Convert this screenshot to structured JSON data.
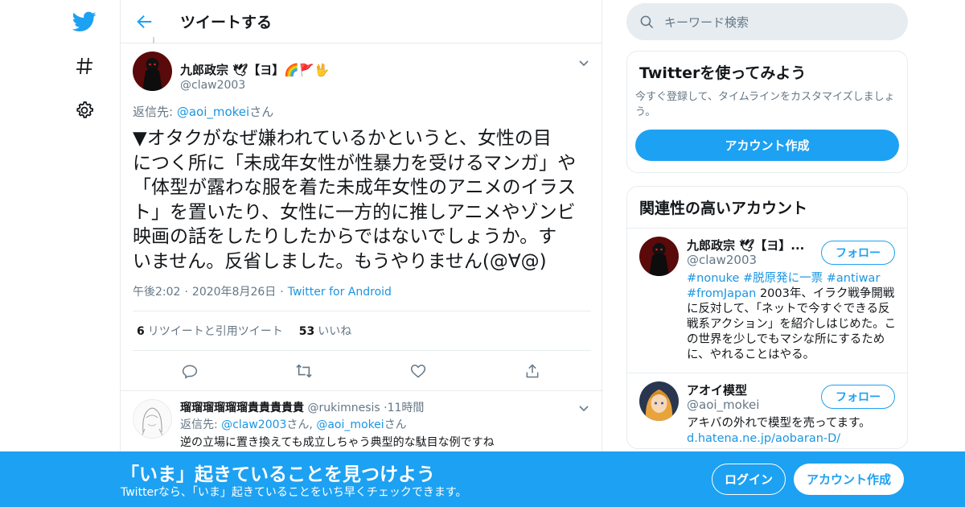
{
  "nav": {
    "logo_icon": "twitter-bird-icon",
    "explore_icon": "hashtag-icon",
    "settings_icon": "gear-icon"
  },
  "header": {
    "title": "ツイートする",
    "back_icon": "arrow-left-icon"
  },
  "tweet": {
    "author_name": "九郎政宗 🕊【ヨ】🌈🚩🖖",
    "author_handle": "@claw2003",
    "reply_prefix": "返信先: ",
    "reply_to": "@aoi_mokei",
    "reply_suffix": "さん",
    "text": "▼オタクがなぜ嫌われているかというと、女性の目\nにつく所に「未成年女性が性暴力を受けるマンガ」や\n「体型が露わな服を着た未成年女性のアニメのイラス\nト」を置いたり、女性に一方的に推しアニメやゾンビ\n映画の話をしたりしたからではないでしょうか。す\nいません。反省しました。もうやりません(@∀@)",
    "time": "午後2:02",
    "date": "2020年8月26日",
    "source": "Twitter for Android",
    "retweets_count": "6",
    "retweets_label": "リツイートと引用ツイート",
    "likes_count": "53",
    "likes_label": "いいね"
  },
  "reply": {
    "name": "瑠瑠瑠瑠瑠瑠貴貴貴貴貴",
    "handle": "@rukimnesis",
    "time": "11時間",
    "reply_prefix": "返信先: ",
    "reply_to_1": "@claw2003",
    "mid": "さん, ",
    "reply_to_2": "@aoi_mokei",
    "reply_suffix": "さん",
    "text": "逆の立場に置き換えても成立しちゃう典型的な駄目な例ですね"
  },
  "search": {
    "placeholder": "キーワード検索"
  },
  "signup_card": {
    "title": "Twitterを使ってみよう",
    "description": "今すぐ登録して、タイムラインをカスタマイズしましょう。",
    "button": "アカウント作成"
  },
  "related": {
    "title": "関連性の高いアカウント",
    "accounts": [
      {
        "name": "九郎政宗 🕊【ヨ】...",
        "handle": "@claw2003",
        "follow": "フォロー",
        "bio_tags": "#nonuke #脱原発に一票 #antiwar #fromJapan",
        "bio_text": " 2003年、イラク戦争開戦に反対して、「ネットで今すぐできる反戦系アクション」を紹介しはじめた。この世界を少しでもマシな所にするために、やれることはやる。"
      },
      {
        "name": "アオイ模型",
        "handle": "@aoi_mokei",
        "follow": "フォロー",
        "bio_text": "アキバの外れで模型を売ってます。",
        "bio_link": "d.hatena.ne.jp/aobaran-D/"
      }
    ]
  },
  "banner": {
    "headline": "「いま」起きていることを見つけよう",
    "sub": "Twitterなら、「いま」起きていることをいち早くチェックできます。",
    "login": "ログイン",
    "signup": "アカウント作成"
  },
  "colors": {
    "accent": "#1da1f2",
    "link": "#1b95e0",
    "muted": "#657786",
    "border": "#e6ecf0"
  }
}
